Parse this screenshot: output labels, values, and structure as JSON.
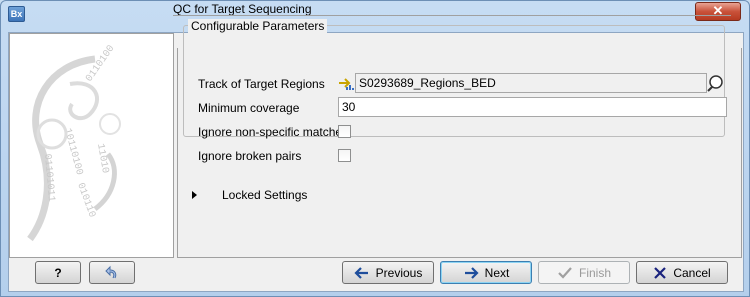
{
  "window": {
    "app_icon_text": "Bx",
    "close_glyph": "✕"
  },
  "wizard": {
    "step_title": "QC for Target Sequencing"
  },
  "params": {
    "group_title": "Configurable Parameters",
    "track_label": "Track of Target Regions",
    "track_value": "S0293689_Regions_BED",
    "min_cov_label": "Minimum coverage",
    "min_cov_value": "30",
    "ignore_nonspecific_label": "Ignore non-specific matches",
    "ignore_nonspecific_checked": false,
    "ignore_broken_label": "Ignore broken pairs",
    "ignore_broken_checked": false
  },
  "locked": {
    "label": "Locked Settings"
  },
  "buttons": {
    "help": "?",
    "previous": "Previous",
    "next": "Next",
    "finish": "Finish",
    "cancel": "Cancel"
  },
  "icons": {
    "track": "track-arrow-icon",
    "browse": "browse-magnifier-icon",
    "reset": "reset-arrow-icon",
    "previous": "left-arrow-icon",
    "next": "right-arrow-icon",
    "finish": "checkmark-icon",
    "cancel": "cross-icon"
  },
  "colors": {
    "accent_blue": "#1f4e9c",
    "cancel_red": "#1a237e"
  }
}
